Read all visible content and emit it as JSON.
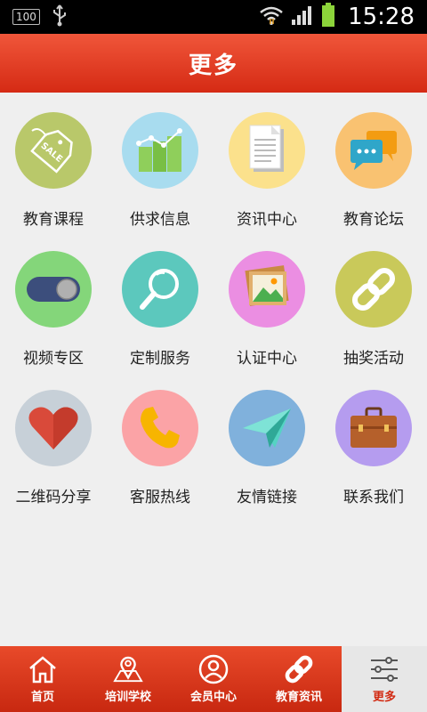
{
  "status_bar": {
    "battery_text": "100",
    "time": "15:28",
    "icons": [
      "battery-level-icon",
      "usb-icon",
      "wifi-icon",
      "signal-icon",
      "battery-icon"
    ]
  },
  "header": {
    "title": "更多"
  },
  "colors": {
    "header_red": "#e0391f",
    "nav_red": "#d6351a",
    "active_label": "#d22a12"
  },
  "grid": {
    "items": [
      {
        "label": "教育课程",
        "icon": "sale-tag-icon",
        "bg": "#b9c86a"
      },
      {
        "label": "供求信息",
        "icon": "bar-chart-icon",
        "bg": "#a8dcef"
      },
      {
        "label": "资讯中心",
        "icon": "document-icon",
        "bg": "#fbe18c"
      },
      {
        "label": "教育论坛",
        "icon": "chat-bubbles-icon",
        "bg": "#f9c271"
      },
      {
        "label": "视频专区",
        "icon": "toggle-switch-icon",
        "bg": "#84d67a"
      },
      {
        "label": "定制服务",
        "icon": "magnifier-icon",
        "bg": "#5cc8bd"
      },
      {
        "label": "认证中心",
        "icon": "picture-icon",
        "bg": "#eb8ee2"
      },
      {
        "label": "抽奖活动",
        "icon": "chain-link-icon",
        "bg": "#c9c95a"
      },
      {
        "label": "二维码分享",
        "icon": "heart-icon",
        "bg": "#c7d0d8"
      },
      {
        "label": "客服热线",
        "icon": "phone-icon",
        "bg": "#fba3a6"
      },
      {
        "label": "友情链接",
        "icon": "paper-plane-icon",
        "bg": "#80b1dc"
      },
      {
        "label": "联系我们",
        "icon": "briefcase-icon",
        "bg": "#b59cef"
      }
    ]
  },
  "bottom_nav": {
    "items": [
      {
        "label": "首页",
        "icon": "home-icon",
        "active": false
      },
      {
        "label": "培训学校",
        "icon": "map-pin-icon",
        "active": false
      },
      {
        "label": "会员中心",
        "icon": "user-icon",
        "active": false
      },
      {
        "label": "教育资讯",
        "icon": "link-icon",
        "active": false
      },
      {
        "label": "更多",
        "icon": "sliders-icon",
        "active": true
      }
    ]
  }
}
